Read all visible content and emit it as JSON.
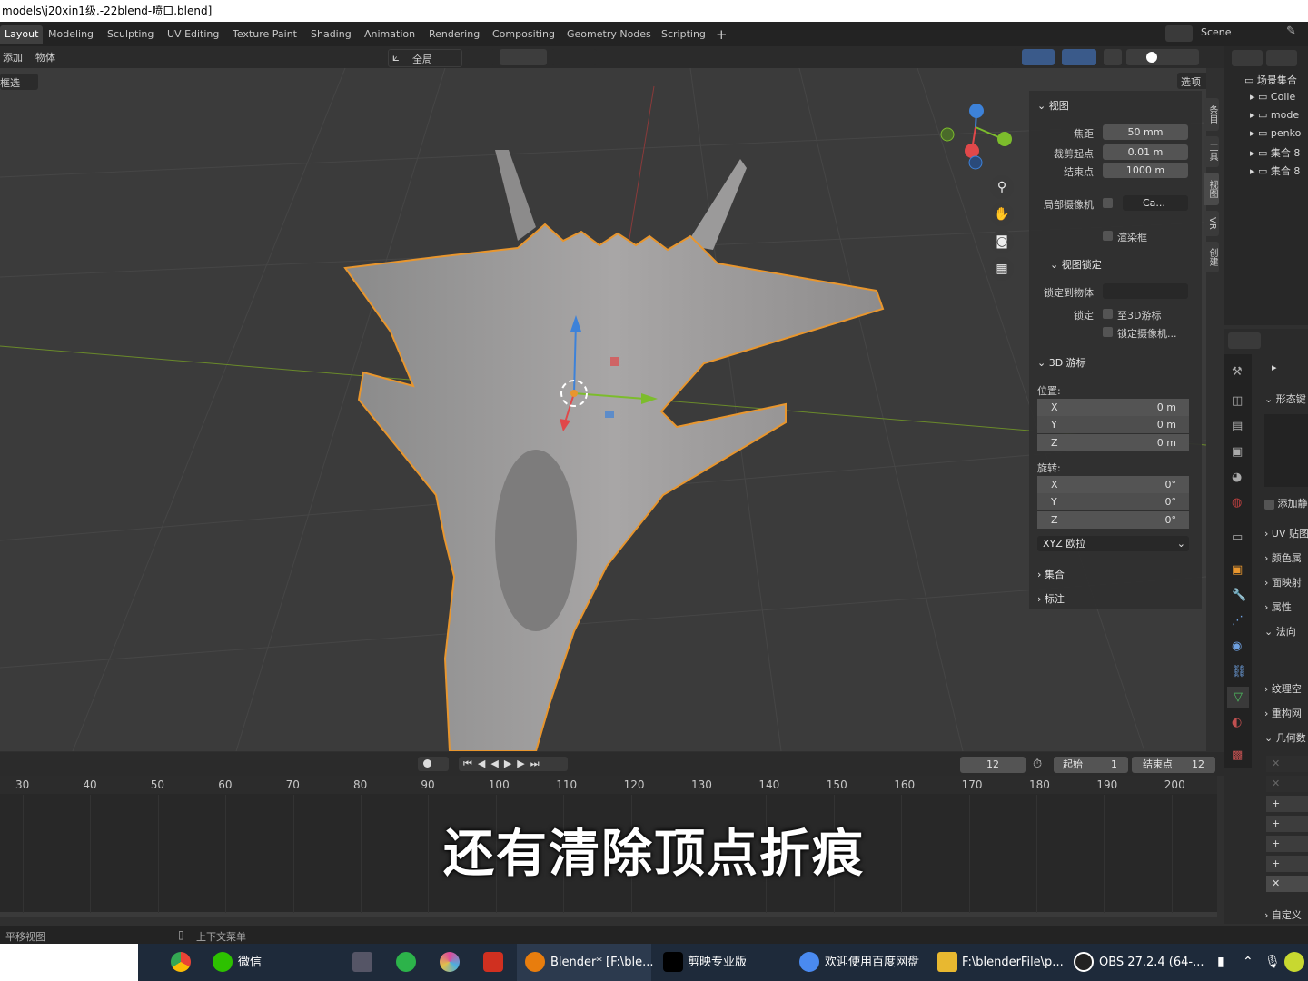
{
  "window_title": "models\\j20xin1级.-22blend-喷口.blend]",
  "workspace_tabs": [
    "Layout",
    "Modeling",
    "Sculpting",
    "UV Editing",
    "Texture Paint",
    "Shading",
    "Animation",
    "Rendering",
    "Compositing",
    "Geometry Nodes",
    "Scripting",
    "+"
  ],
  "scene": "Scene",
  "header": {
    "add": "添加",
    "object": "物体",
    "transform_orientation": "全局",
    "select_mode": "框选",
    "options": "选项"
  },
  "npanel": {
    "view_section": "视图",
    "focal_label": "焦距",
    "focal_value": "50 mm",
    "clip_start_label": "裁剪起点",
    "clip_start_value": "0.01 m",
    "clip_end_label": "结束点",
    "clip_end_value": "1000 m",
    "local_camera_label": "局部摄像机",
    "local_camera_value": "Ca...",
    "render_region": "渲染框",
    "view_lock_section": "视图锁定",
    "lock_to_object_label": "锁定到物体",
    "lock_label": "锁定",
    "lock_to_cursor": "至3D游标",
    "lock_camera": "锁定摄像机...",
    "cursor_section": "3D 游标",
    "location_label": "位置:",
    "location": [
      {
        "k": "X",
        "v": "0 m"
      },
      {
        "k": "Y",
        "v": "0 m"
      },
      {
        "k": "Z",
        "v": "0 m"
      }
    ],
    "rotation_label": "旋转:",
    "rotation": [
      {
        "k": "X",
        "v": "0°"
      },
      {
        "k": "Y",
        "v": "0°"
      },
      {
        "k": "Z",
        "v": "0°"
      }
    ],
    "rotation_mode": "XYZ 欧拉",
    "collections_section": "集合",
    "annotations_section": "标注"
  },
  "npanel_tabs": [
    "条目",
    "工具",
    "视图",
    "VR",
    "创建"
  ],
  "outliner": {
    "title": "场景集合",
    "items": [
      "Colle",
      "mode",
      "penko",
      "集合 8",
      "集合 8"
    ]
  },
  "properties": {
    "shape_keys": "形态键",
    "add_rest": "添加静",
    "uv_maps": "UV 贴图",
    "color_attrs": "颜色属",
    "face_maps": "面映射",
    "attributes": "属性",
    "normals": "法向",
    "texture_space": "纹理空",
    "remesh": "重构网",
    "geometry_data": "几何数",
    "custom": "自定义"
  },
  "timeline": {
    "current_frame": "12",
    "start_label": "起始",
    "start_value": "1",
    "end_label": "结束点",
    "end_value": "12",
    "ticks": [
      "30",
      "40",
      "50",
      "60",
      "70",
      "80",
      "90",
      "100",
      "110",
      "120",
      "130",
      "140",
      "150",
      "160",
      "170",
      "180",
      "190",
      "200"
    ]
  },
  "statusbar": {
    "pan_view": "平移视图",
    "context_menu": "上下文菜单"
  },
  "subtitle": "还有清除顶点折痕",
  "taskbar": [
    {
      "label": "微信"
    },
    {
      "label": "Blender* [F:\\ble..."
    },
    {
      "label": "剪映专业版"
    },
    {
      "label": "欢迎使用百度网盘"
    },
    {
      "label": "F:\\blenderFile\\p..."
    },
    {
      "label": "OBS 27.2.4 (64-..."
    }
  ],
  "colors": {
    "selection_outline": "#f0a030",
    "x_axis": "#e0484a",
    "y_axis": "#7cbc2c",
    "z_axis": "#3d82d9"
  }
}
